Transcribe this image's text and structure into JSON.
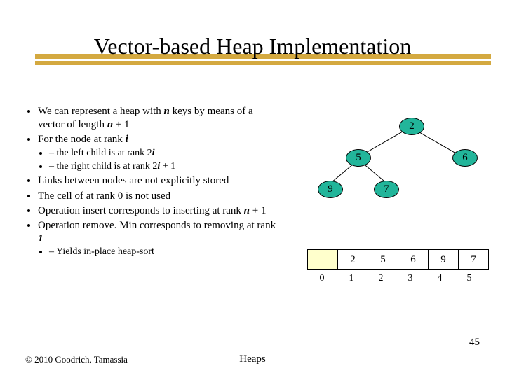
{
  "title": "Vector-based Heap Implementation",
  "bullets": {
    "b1a": "We can represent a heap with ",
    "b1b": " keys by means of a vector of length ",
    "b1c": " + 1",
    "b2a": "For the node at rank ",
    "s1a": "the left child is at rank 2",
    "s2a": "the right child is at rank 2",
    "s2b": " + 1",
    "b3": "Links between nodes are not explicitly stored",
    "b4": "The cell of at rank 0 is not used",
    "b5a": "Operation insert corresponds to inserting at rank ",
    "b5b": " + 1",
    "b6a": "Operation remove. Min corresponds to removing at rank ",
    "sub3": "Yields in-place heap-sort"
  },
  "tree": {
    "n1": "2",
    "n2": "5",
    "n3": "6",
    "n4": "9",
    "n5": "7"
  },
  "array": {
    "a1": "2",
    "a2": "5",
    "a3": "6",
    "a4": "9",
    "a5": "7"
  },
  "idx": {
    "i0": "0",
    "i1": "1",
    "i2": "2",
    "i3": "3",
    "i4": "4",
    "i5": "5"
  },
  "footer": {
    "copy": "© 2010 Goodrich, Tamassia",
    "center": "Heaps",
    "num": "45"
  }
}
